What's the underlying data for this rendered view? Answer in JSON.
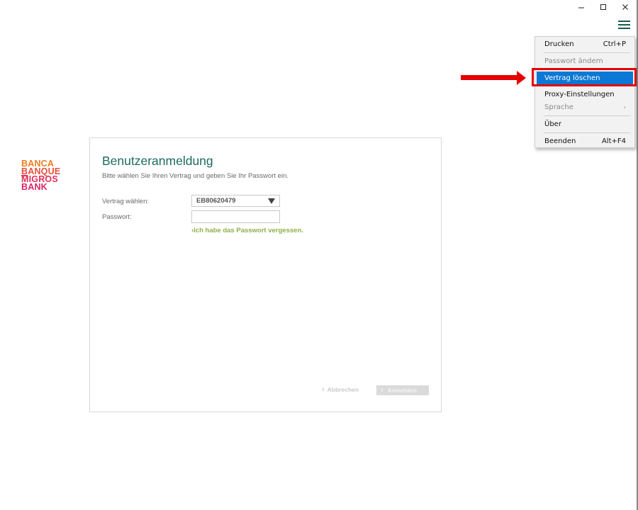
{
  "window_controls": {
    "minimize_icon": "minimize-icon",
    "maximize_icon": "maximize-icon",
    "close_icon": "close-icon"
  },
  "app_menu_icon": "hamburger-menu-icon",
  "logo": {
    "line1": "BANCA",
    "line2": "BANQUE",
    "line3": "MIGROS",
    "line4": "BANK",
    "colors": [
      "#ef7d1d",
      "#e94e3c",
      "#e3305a",
      "#dd2264"
    ]
  },
  "login": {
    "title": "Benutzeranmeldung",
    "subtitle": "Bitte wählen Sie Ihren Vertrag und geben Sie Ihr Passwort ein.",
    "contract_label": "Vertrag wählen:",
    "contract_value": "EB80620479",
    "password_label": "Passwort:",
    "password_value": "",
    "forgot_link": "Ich habe das Passwort vergessen.",
    "cancel_label": "Abbrechen",
    "login_label": "Anmelden",
    "accent_color": "#1c6b5f",
    "link_color": "#8fb04a"
  },
  "menu": {
    "items": [
      {
        "label": "Drucken",
        "shortcut": "Ctrl+P",
        "state": "enabled"
      },
      {
        "label": "Passwort ändern",
        "shortcut": "",
        "state": "disabled"
      },
      {
        "label": "Vertrag löschen",
        "shortcut": "",
        "state": "selected"
      },
      {
        "label": "Proxy-Einstellungen",
        "shortcut": "",
        "state": "enabled"
      },
      {
        "label": "Sprache",
        "shortcut": "",
        "state": "disabled",
        "submenu": true
      },
      {
        "label": "Über",
        "shortcut": "",
        "state": "enabled"
      },
      {
        "label": "Beenden",
        "shortcut": "Alt+F4",
        "state": "enabled"
      }
    ],
    "selection_color": "#0a78d4"
  },
  "annotation": {
    "arrow_color": "#e40000",
    "highlight_color": "#e40000"
  }
}
